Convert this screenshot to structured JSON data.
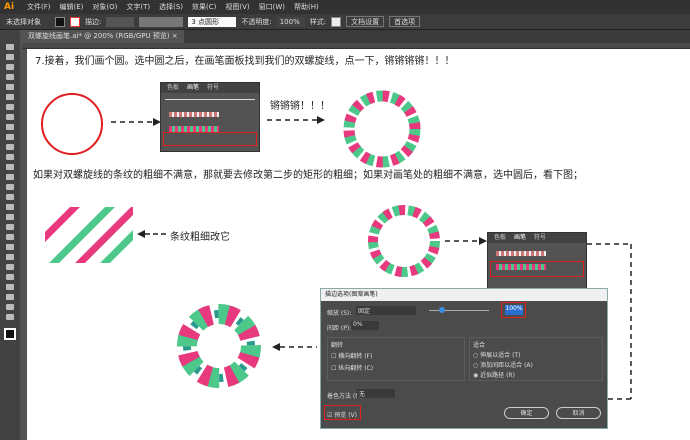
{
  "app": {
    "logo": "Ai",
    "menus": [
      "文件(F)",
      "编辑(E)",
      "对象(O)",
      "文字(T)",
      "选择(S)",
      "效果(C)",
      "视图(V)",
      "窗口(W)",
      "帮助(H)"
    ]
  },
  "control": {
    "selection": "未选择对象",
    "stroke_label": "描边:",
    "brush": "3 点圆形",
    "opacity_label": "不透明度:",
    "opacity": "100%",
    "style_label": "样式:",
    "doc_setup": "文档设置",
    "prefs": "首选项"
  },
  "doc_tab": {
    "title": "双螺旋线画笔.ai* @ 200% (RGB/GPU 预览)",
    "close": "×"
  },
  "tutorial": {
    "step7": "7.接着，我们画个圆。选中圆之后，在画笔面板找到我们的双螺旋线，点一下，锵锵锵锵！！！",
    "cheer": "锵锵锵！！！",
    "note": "如果对双螺旋线的条纹的粗细不满意，那就要去修改第二步的矩形的粗细；如果对画笔处的粗细不满意，选中圆后，看下图；",
    "stripe_label": "条纹粗细改它"
  },
  "brush_panel": {
    "tabs": [
      "色板",
      "画笔",
      "符号"
    ]
  },
  "dialog": {
    "title": "描边选项(图案画笔)",
    "scale_label": "缩放 (S):",
    "scale_mode": "固定",
    "scale_value": "100%",
    "spacing_label": "间距 (P):",
    "spacing_value": "0%",
    "flip_title": "翻转",
    "flip_h": "横向翻转 (F)",
    "flip_v": "纵向翻转 (C)",
    "fit_title": "适合",
    "fit_stretch": "伸展以适合 (T)",
    "fit_space": "添加间距以适合 (A)",
    "fit_approx": "近似路径 (R)",
    "colorize_label": "着色方法 (M):",
    "colorize_value": "无",
    "preview": "预览 (V)",
    "ok": "确定",
    "cancel": "取消"
  },
  "colors": {
    "pink": "#e8387e",
    "green": "#4cc88a",
    "teal": "#2a9a8e",
    "red": "#e02020"
  }
}
